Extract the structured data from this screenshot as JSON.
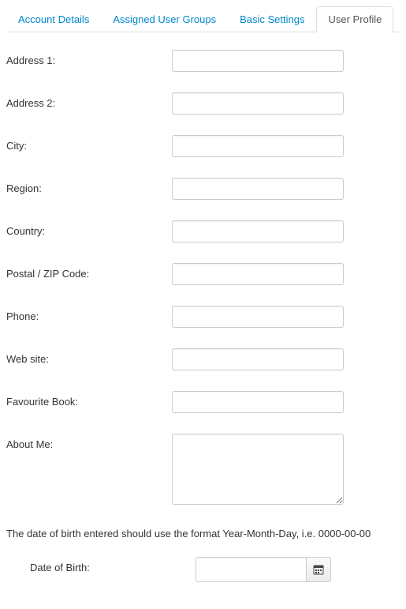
{
  "tabs": [
    {
      "label": "Account Details",
      "active": false
    },
    {
      "label": "Assigned User Groups",
      "active": false
    },
    {
      "label": "Basic Settings",
      "active": false
    },
    {
      "label": "User Profile",
      "active": true
    }
  ],
  "fields": {
    "address1": {
      "label": "Address 1:",
      "value": ""
    },
    "address2": {
      "label": "Address 2:",
      "value": ""
    },
    "city": {
      "label": "City:",
      "value": ""
    },
    "region": {
      "label": "Region:",
      "value": ""
    },
    "country": {
      "label": "Country:",
      "value": ""
    },
    "postal": {
      "label": "Postal / ZIP Code:",
      "value": ""
    },
    "phone": {
      "label": "Phone:",
      "value": ""
    },
    "website": {
      "label": "Web site:",
      "value": ""
    },
    "favbook": {
      "label": "Favourite Book:",
      "value": ""
    },
    "aboutme": {
      "label": "About Me:",
      "value": ""
    },
    "dob": {
      "label": "Date of Birth:",
      "value": ""
    }
  },
  "hint": "The date of birth entered should use the format Year-Month-Day, i.e. 0000-00-00"
}
